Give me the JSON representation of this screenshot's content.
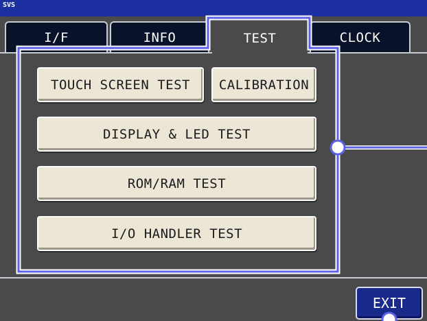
{
  "header": {
    "label": "SVS"
  },
  "tabs": [
    {
      "label": "I/F",
      "active": false
    },
    {
      "label": "INFO",
      "active": false
    },
    {
      "label": "TEST",
      "active": true
    },
    {
      "label": "CLOCK",
      "active": false
    }
  ],
  "buttons": {
    "touch_screen_test": "TOUCH SCREEN TEST",
    "calibration": "CALIBRATION",
    "display_led_test": "DISPLAY & LED TEST",
    "rom_ram_test": "ROM/RAM TEST",
    "io_handler_test": "I/O HANDLER TEST"
  },
  "exit_label": "EXIT",
  "colors": {
    "header_blue": "#1c2fa0",
    "tab_dark": "#081228",
    "background_gray": "#4a4a4a",
    "button_face": "#ece6d6",
    "exit_blue": "#1a2a8a",
    "callout": "#5b62e6"
  }
}
